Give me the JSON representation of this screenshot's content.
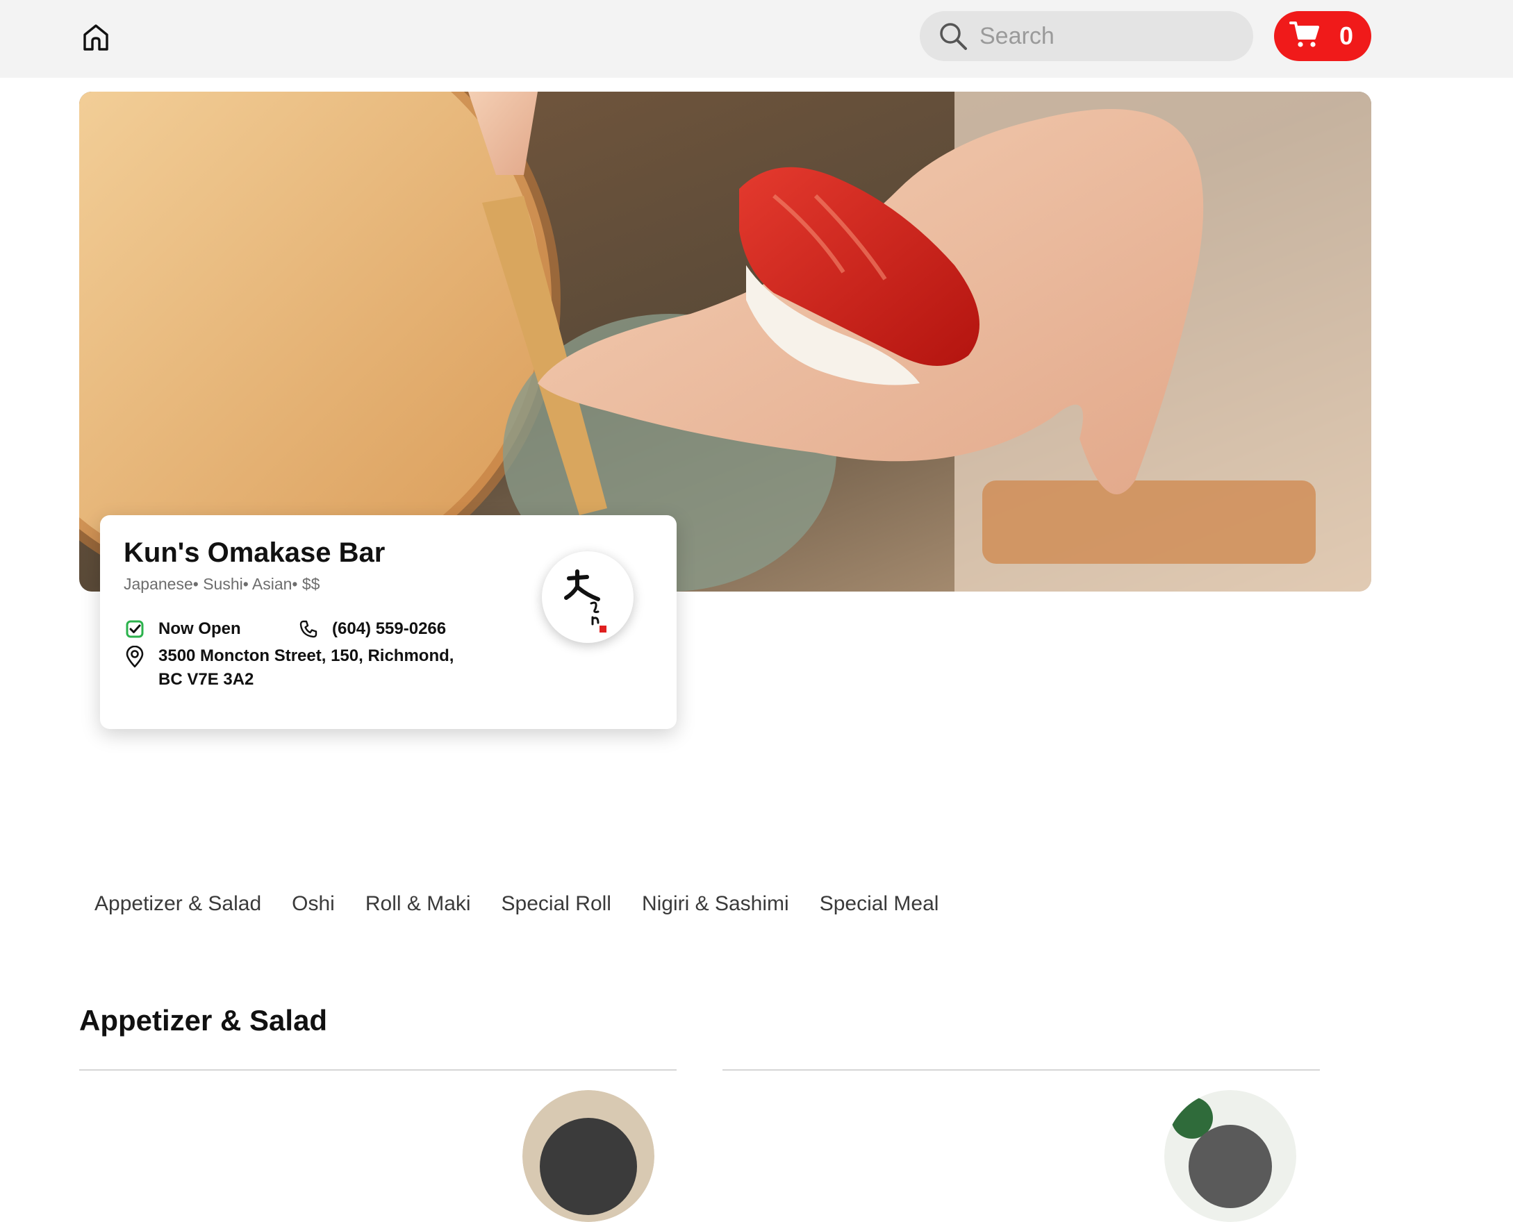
{
  "header": {
    "home_icon": "home-icon",
    "search": {
      "placeholder": "Search",
      "value": "",
      "icon": "search-icon"
    },
    "cart": {
      "icon": "shopping-cart-icon",
      "count": "0",
      "color": "#f01a1a"
    }
  },
  "restaurant": {
    "name": "Kun's Omakase Bar",
    "tags": "Japanese• Sushi• Asian• $$",
    "status": "Now Open",
    "status_icon": "check-square-icon",
    "status_color": "#2bb24c",
    "phone": "(604) 559-0266",
    "phone_icon": "phone-icon",
    "address": "3500 Moncton Street, 150, Richmond, BC V7E 3A2",
    "address_icon": "location-pin-icon"
  },
  "categories": [
    {
      "label": "Appetizer & Salad"
    },
    {
      "label": "Oshi"
    },
    {
      "label": "Roll & Maki"
    },
    {
      "label": "Special Roll"
    },
    {
      "label": "Nigiri & Sashimi"
    },
    {
      "label": "Special Meal"
    }
  ],
  "section": {
    "title": "Appetizer & Salad"
  }
}
